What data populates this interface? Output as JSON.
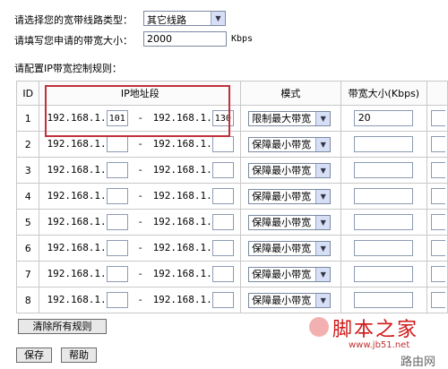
{
  "form": {
    "type_label": "请选择您的宽带线路类型：",
    "type_value": "其它线路",
    "bandwidth_label": "请填写您申请的带宽大小：",
    "bandwidth_value": "2000",
    "bandwidth_unit": "Kbps",
    "rules_label": "请配置IP带宽控制规则："
  },
  "table": {
    "headers": {
      "id": "ID",
      "ip": "IP地址段",
      "mode": "模式",
      "bw": "带宽大小(Kbps)"
    },
    "ip_prefix": "192.168.1.",
    "separator": "-",
    "rows": [
      {
        "id": "1",
        "start": "101",
        "end": "130",
        "mode": "限制最大带宽",
        "bw": "20"
      },
      {
        "id": "2",
        "start": "",
        "end": "",
        "mode": "保障最小带宽",
        "bw": ""
      },
      {
        "id": "3",
        "start": "",
        "end": "",
        "mode": "保障最小带宽",
        "bw": ""
      },
      {
        "id": "4",
        "start": "",
        "end": "",
        "mode": "保障最小带宽",
        "bw": ""
      },
      {
        "id": "5",
        "start": "",
        "end": "",
        "mode": "保障最小带宽",
        "bw": ""
      },
      {
        "id": "6",
        "start": "",
        "end": "",
        "mode": "保障最小带宽",
        "bw": ""
      },
      {
        "id": "7",
        "start": "",
        "end": "",
        "mode": "保障最小带宽",
        "bw": ""
      },
      {
        "id": "8",
        "start": "",
        "end": "",
        "mode": "保障最小带宽",
        "bw": ""
      }
    ]
  },
  "buttons": {
    "clear": "清除所有规则",
    "save": "保存",
    "help": "帮助"
  },
  "watermark": {
    "brand": "脚本之家",
    "url": "www.jb51.net",
    "corner": "路由网"
  }
}
